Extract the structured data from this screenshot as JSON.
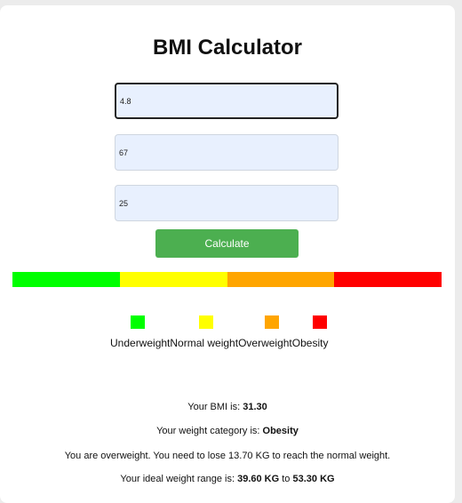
{
  "title": "BMI Calculator",
  "inputs": {
    "height": "4.8",
    "weight": "67",
    "age": "25"
  },
  "calculate_label": "Calculate",
  "scale_colors": [
    "#00ff00",
    "#ffff00",
    "#ffa500",
    "#ff0000"
  ],
  "legend": [
    {
      "label": "Underweight",
      "color": "#00ff00"
    },
    {
      "label": "Normal weight",
      "color": "#ffff00"
    },
    {
      "label": "Overweight",
      "color": "#ffa500"
    },
    {
      "label": "Obesity",
      "color": "#ff0000"
    }
  ],
  "results": {
    "bmi_prefix": "Your BMI is: ",
    "bmi_value": "31.30",
    "category_prefix": "Your weight category is: ",
    "category_value": "Obesity",
    "advice": "You are overweight. You need to lose 13.70 KG to reach the normal weight.",
    "range_prefix": "Your ideal weight range is: ",
    "range_low": "39.60 KG",
    "range_to": " to ",
    "range_high": "53.30 KG"
  }
}
